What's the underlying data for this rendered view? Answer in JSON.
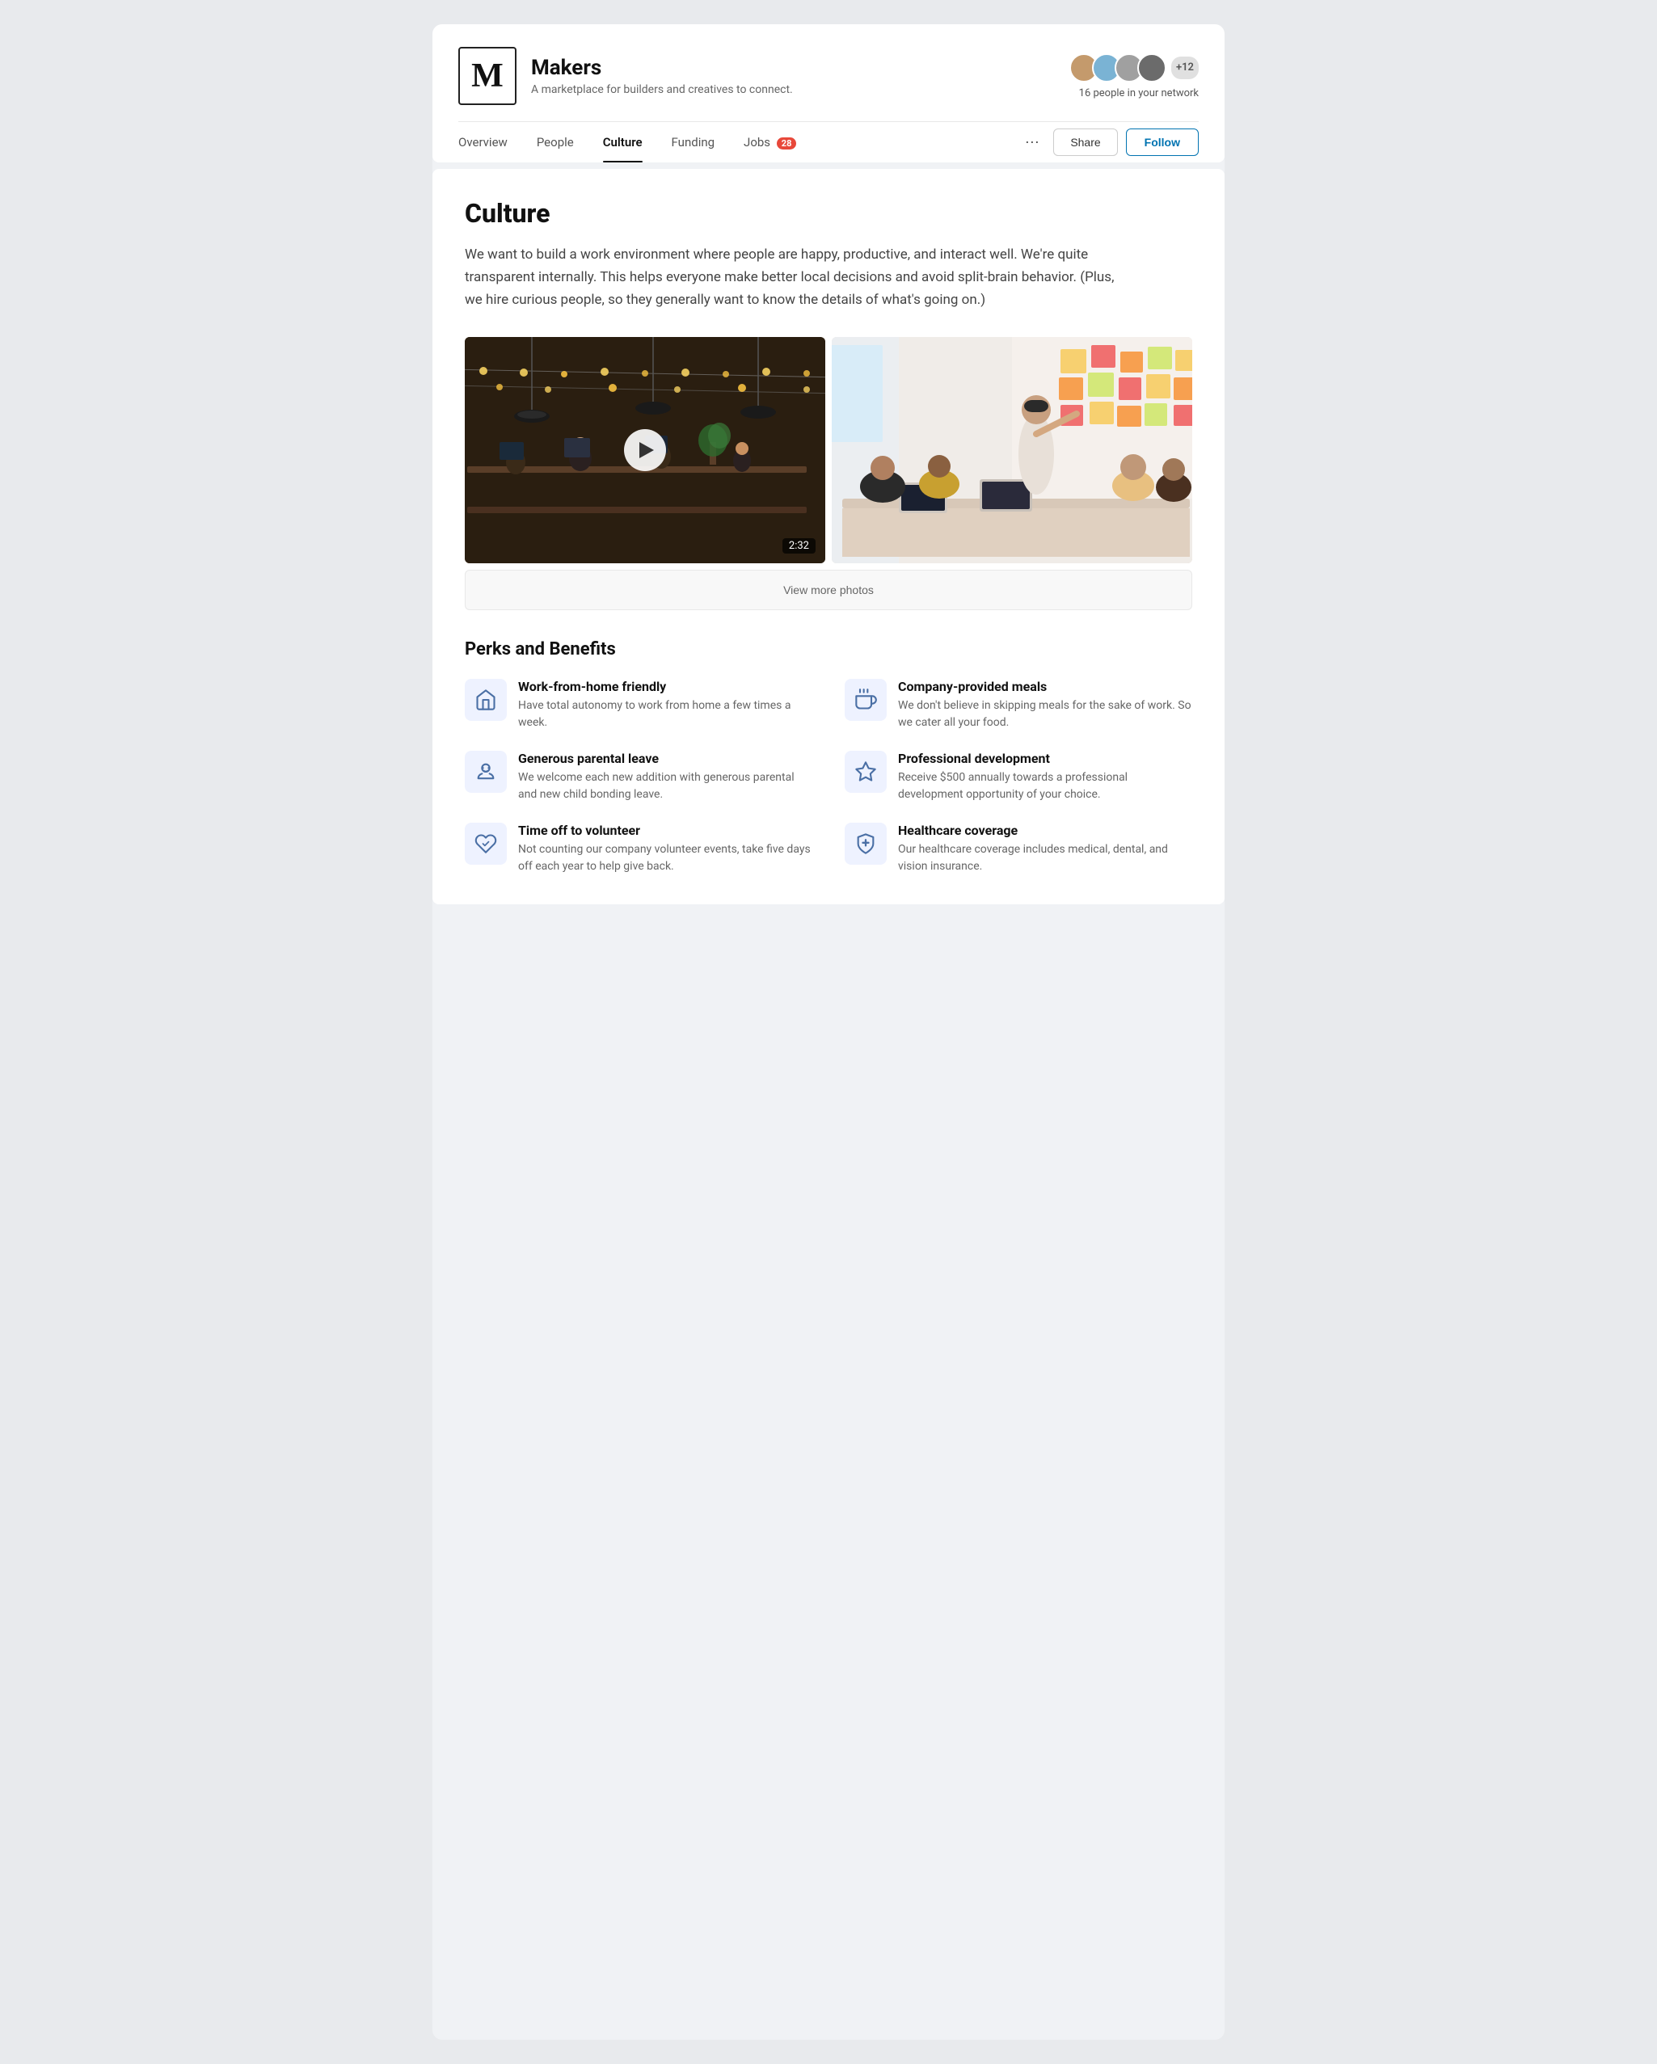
{
  "brand": {
    "logo": "M",
    "name": "Makers",
    "tagline": "A marketplace for builders and creatives to connect."
  },
  "network": {
    "count_label": "+12",
    "description": "16 people in your network"
  },
  "nav": {
    "tabs": [
      {
        "id": "overview",
        "label": "Overview",
        "active": false
      },
      {
        "id": "people",
        "label": "People",
        "active": false
      },
      {
        "id": "culture",
        "label": "Culture",
        "active": true
      },
      {
        "id": "funding",
        "label": "Funding",
        "active": false
      },
      {
        "id": "jobs",
        "label": "Jobs",
        "badge": "28",
        "active": false
      }
    ],
    "share_label": "Share",
    "follow_label": "Follow"
  },
  "culture": {
    "title": "Culture",
    "description": "We want to build a work environment where people are happy, productive, and interact well. We're quite transparent internally. This helps everyone make better local decisions and avoid split-brain behavior. (Plus, we hire curious people, so they generally want to know the details of what's going on.)",
    "video_duration": "2:32",
    "view_more_label": "View more photos"
  },
  "perks": {
    "title": "Perks and Benefits",
    "items": [
      {
        "id": "wfh",
        "name": "Work-from-home friendly",
        "desc": "Have total autonomy to work from home a few times a week.",
        "icon": "house"
      },
      {
        "id": "meals",
        "name": "Company-provided meals",
        "desc": "We don't believe in skipping meals for the sake of work. So we cater all your food.",
        "icon": "food"
      },
      {
        "id": "parental",
        "name": "Generous parental leave",
        "desc": "We welcome each new addition with generous parental and new child bonding leave.",
        "icon": "baby"
      },
      {
        "id": "development",
        "name": "Professional development",
        "desc": "Receive $500 annually towards a professional development opportunity of your choice.",
        "icon": "chart"
      },
      {
        "id": "volunteer",
        "name": "Time off to volunteer",
        "desc": "Not counting our company volunteer events, take five days off each year to help give back.",
        "icon": "volunteer"
      },
      {
        "id": "healthcare",
        "name": "Healthcare coverage",
        "desc": "Our healthcare coverage includes medical, dental, and vision insurance.",
        "icon": "shield"
      }
    ]
  },
  "sticky_colors": [
    "#f7d070",
    "#f7a050",
    "#f06060",
    "#e87878",
    "#f7d070",
    "#f7a050",
    "#d4e87a",
    "#f06060",
    "#f7d070",
    "#f7a050",
    "#f06060",
    "#e87878",
    "#f7d070",
    "#d4e87a",
    "#f7a050",
    "#f06060",
    "#f7d070",
    "#e87878",
    "#f7a050",
    "#f06060"
  ]
}
